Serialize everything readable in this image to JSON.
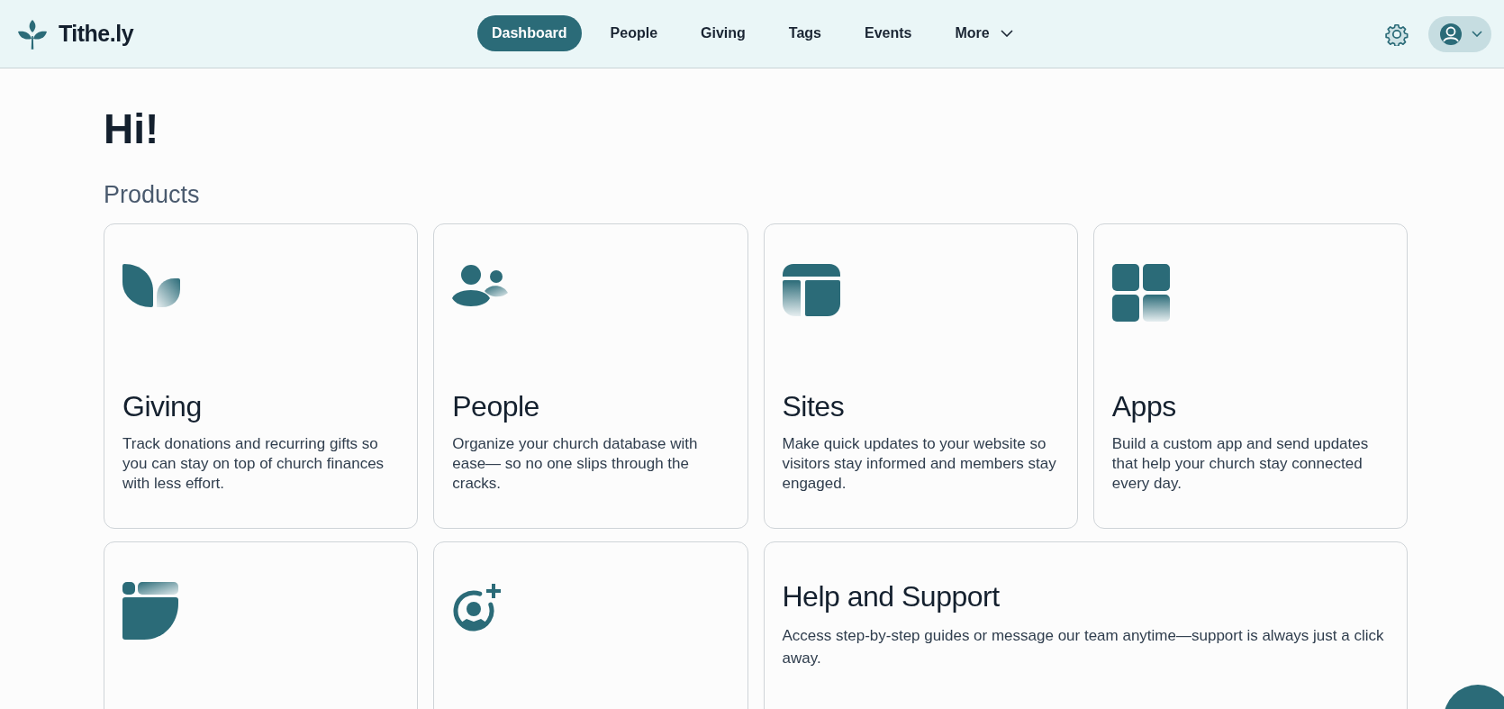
{
  "brand": "Tithe.ly",
  "nav": [
    {
      "label": "Dashboard",
      "selected": true
    },
    {
      "label": "People",
      "selected": false
    },
    {
      "label": "Giving",
      "selected": false
    },
    {
      "label": "Tags",
      "selected": false
    },
    {
      "label": "Events",
      "selected": false
    },
    {
      "label": "More",
      "selected": false,
      "dropdown": true
    }
  ],
  "greeting": "Hi!",
  "section_title": "Products",
  "products": [
    {
      "kind": "giving",
      "title": "Giving",
      "description": "Track donations and recurring gifts so you can stay on top of church finances with less effort."
    },
    {
      "kind": "people",
      "title": "People",
      "description": "Organize your church database with ease— so no one slips through the cracks."
    },
    {
      "kind": "sites",
      "title": "Sites",
      "description": "Make quick updates to your website so visitors stay informed and members stay engaged."
    },
    {
      "kind": "apps",
      "title": "Apps",
      "description": "Build a custom app and send updates that help your church stay connected every day."
    },
    {
      "kind": "media"
    },
    {
      "kind": "adduser"
    }
  ],
  "help": {
    "title": "Help and Support",
    "description": "Access step-by-step guides or message our team anytime—support is always just a click away."
  }
}
